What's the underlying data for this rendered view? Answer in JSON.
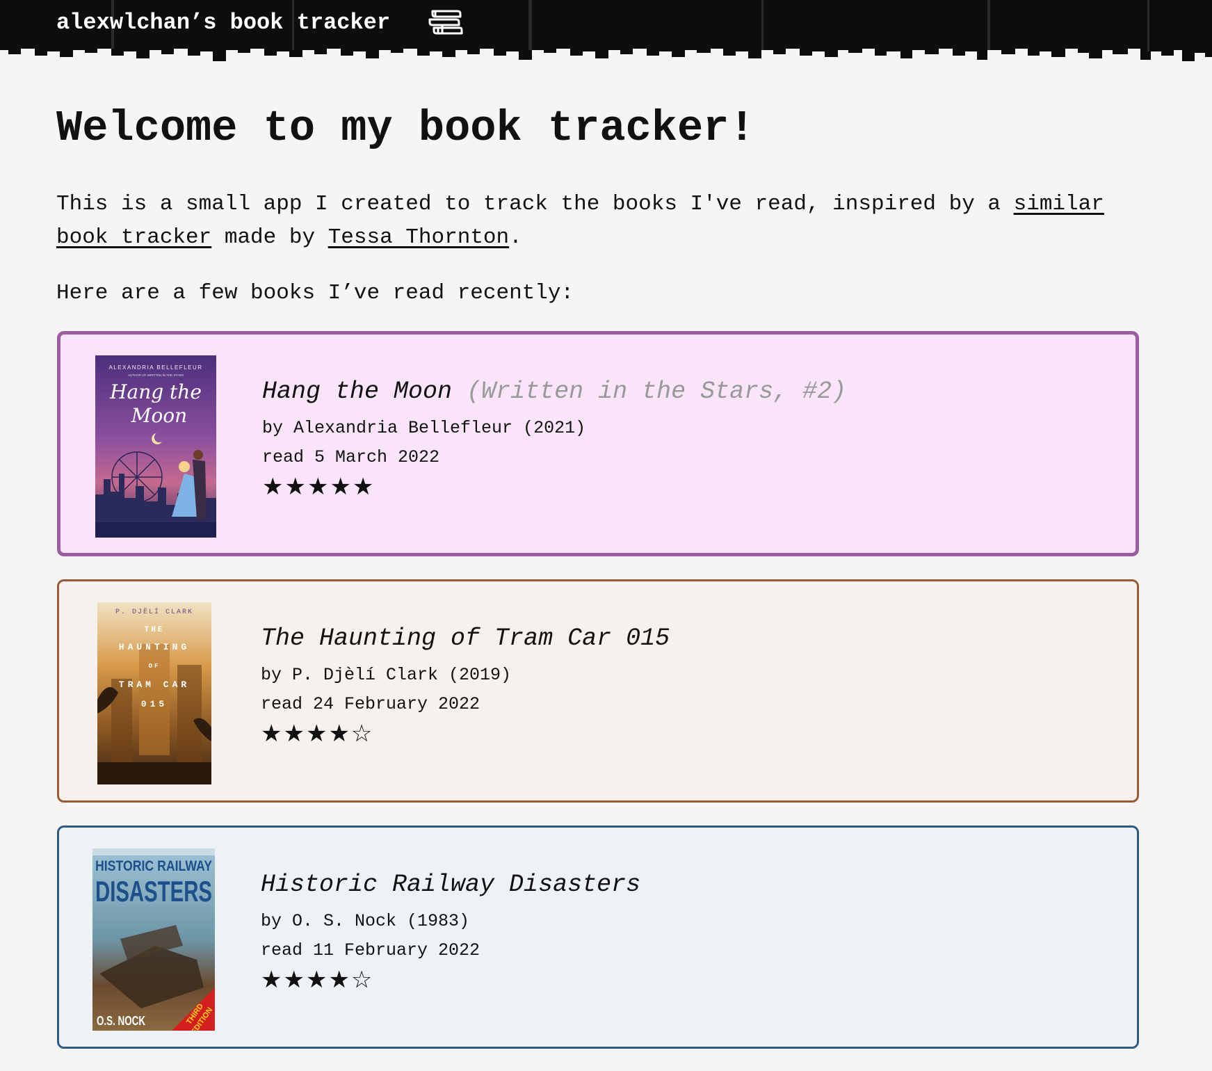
{
  "header": {
    "site_title": "alexwlchan’s book tracker",
    "icon": "books-icon"
  },
  "main": {
    "heading": "Welcome to my book tracker!",
    "intro": {
      "text_before": "This is a small app I created to track the books I've read, inspired by a ",
      "link1": "similar book tracker",
      "text_middle": " made by ",
      "link2": "Tessa Thornton",
      "text_after": "."
    },
    "recent_label": "Here are a few books I’ve read recently:"
  },
  "books": [
    {
      "title": "Hang the Moon",
      "series": "(Written in the Stars, #2)",
      "byline": "by Alexandria Bellefleur (2021)",
      "read": "read 5 March 2022",
      "rating": 5,
      "stars": "★★★★★",
      "cover": {
        "author": "ALEXANDRIA BELLEFLEUR",
        "subtitle": "AUTHOR OF WRITTEN IN THE STARS",
        "title_line1": "Hang the",
        "title_line2": "Moon"
      },
      "colors": {
        "border": "#9a5ea0",
        "background": "#f9e4fa"
      }
    },
    {
      "title": "The Haunting of Tram Car 015",
      "series": "",
      "byline": "by P. Djèlí Clark (2019)",
      "read": "read 24 February 2022",
      "rating": 4,
      "stars": "★★★★☆",
      "cover": {
        "author": "P. DJÈLÍ CLARK",
        "line1": "THE",
        "line2": "HAUNTING",
        "line3": "OF",
        "line4": "TRAM CAR",
        "line5": "015"
      },
      "colors": {
        "border": "#9a5b32",
        "background": "#f7f1ee"
      }
    },
    {
      "title": "Historic Railway Disasters",
      "series": "",
      "byline": "by O. S. Nock (1983)",
      "read": "read 11 February 2022",
      "rating": 4,
      "stars": "★★★★☆",
      "cover": {
        "title_line1": "HISTORIC RAILWAY",
        "title_line2": "DISASTERS",
        "author": "O.S. NOCK",
        "edition_line1": "THIRD",
        "edition_line2": "EDITION"
      },
      "colors": {
        "border": "#2f5b82",
        "background": "#eef2f6"
      }
    }
  ]
}
